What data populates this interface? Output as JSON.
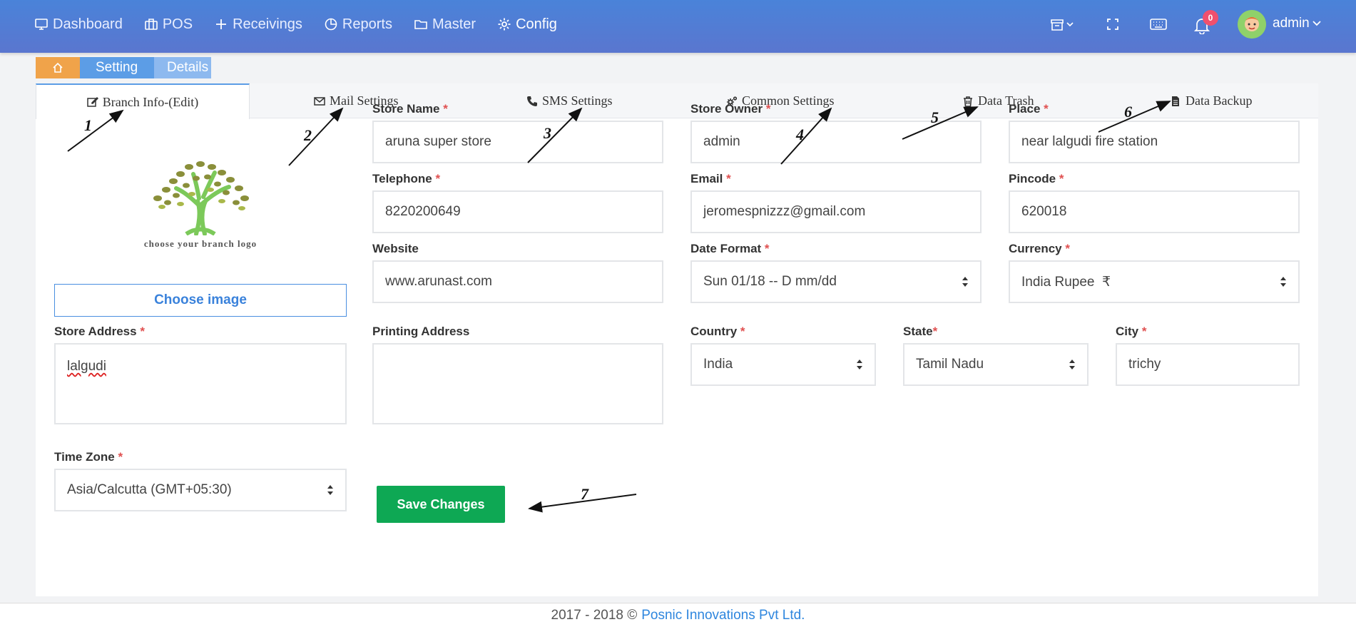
{
  "nav": {
    "items": [
      {
        "label": "Dashboard",
        "icon": "monitor-icon"
      },
      {
        "label": "POS",
        "icon": "briefcase-icon"
      },
      {
        "label": "Receivings",
        "icon": "plus-icon"
      },
      {
        "label": "Reports",
        "icon": "pie-chart-icon"
      },
      {
        "label": "Master",
        "icon": "folder-icon"
      },
      {
        "label": "Config",
        "icon": "gear-icon"
      }
    ],
    "notification_count": "0",
    "user": "admin"
  },
  "breadcrumb": [
    "Setting",
    "Details"
  ],
  "tabs": [
    {
      "label": "Branch Info-(Edit)",
      "icon": "edit-icon"
    },
    {
      "label": "Mail Settings",
      "icon": "mail-icon"
    },
    {
      "label": "SMS Settings",
      "icon": "phone-icon"
    },
    {
      "label": "Common Settings",
      "icon": "gears-icon"
    },
    {
      "label": "Data Trash",
      "icon": "trash-icon"
    },
    {
      "label": "Data Backup",
      "icon": "file-icon"
    }
  ],
  "logo": {
    "caption": "choose your branch logo",
    "button": "Choose image"
  },
  "form": {
    "store_name": {
      "label": "Store Name",
      "value": "aruna super store"
    },
    "store_owner": {
      "label": "Store Owner",
      "value": "admin"
    },
    "place": {
      "label": "Place",
      "value": "near lalgudi fire station"
    },
    "telephone": {
      "label": "Telephone",
      "value": "8220200649"
    },
    "email": {
      "label": "Email",
      "value": "jeromespnizzz@gmail.com"
    },
    "pincode": {
      "label": "Pincode",
      "value": "620018"
    },
    "website": {
      "label": "Website",
      "value": "www.arunast.com"
    },
    "date_format": {
      "label": "Date Format",
      "value": "Sun 01/18 -- D mm/dd"
    },
    "currency": {
      "label": "Currency",
      "value": "India Rupee  ₹"
    },
    "store_address": {
      "label": "Store Address",
      "value": "lalgudi"
    },
    "printing_address": {
      "label": "Printing Address",
      "value": ""
    },
    "country": {
      "label": "Country",
      "value": "India"
    },
    "state": {
      "label": "State",
      "value": "Tamil Nadu"
    },
    "city": {
      "label": "City",
      "value": "trichy"
    },
    "time_zone": {
      "label": "Time Zone",
      "value": "Asia/Calcutta (GMT+05:30)"
    },
    "required_mark": "*"
  },
  "save_label": "Save Changes",
  "footer": {
    "text": "2017 - 2018 ©",
    "link": "Posnic Innovations Pvt Ltd."
  },
  "annotations": [
    "1",
    "2",
    "3",
    "4",
    "5",
    "6",
    "7"
  ],
  "colors": {
    "topbar": "#4a83d9",
    "save": "#0ea854",
    "accent": "#3a82db",
    "required": "#e05050"
  }
}
